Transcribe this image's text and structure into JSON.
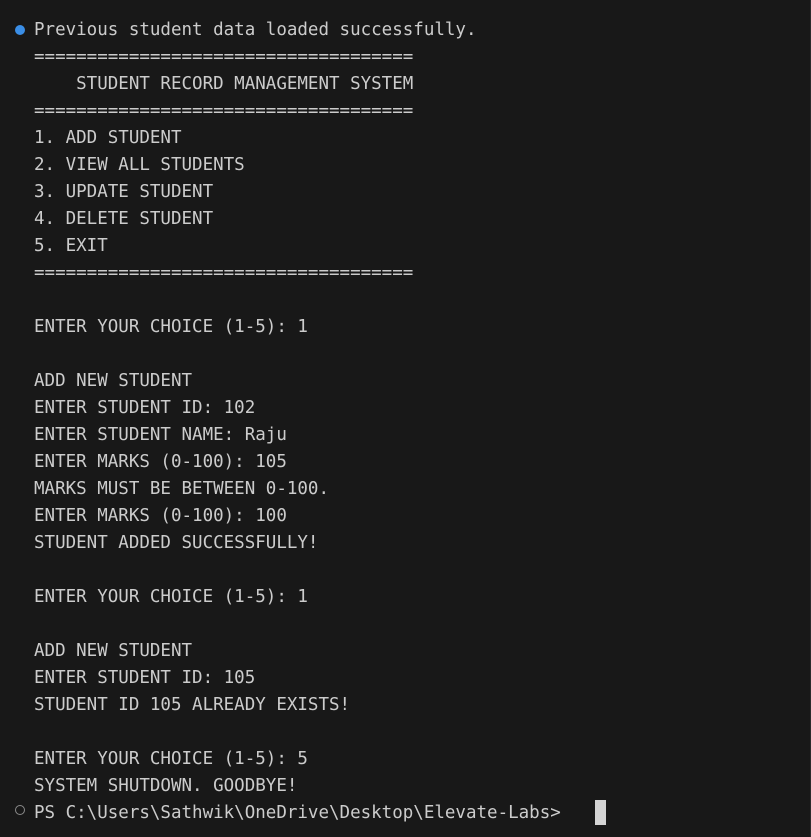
{
  "terminal": {
    "lines": [
      "Previous student data loaded successfully.",
      "====================================",
      "    STUDENT RECORD MANAGEMENT SYSTEM",
      "====================================",
      "1. ADD STUDENT",
      "2. VIEW ALL STUDENTS",
      "3. UPDATE STUDENT",
      "4. DELETE STUDENT",
      "5. EXIT",
      "====================================",
      "",
      "ENTER YOUR CHOICE (1-5): 1",
      "",
      "ADD NEW STUDENT",
      "ENTER STUDENT ID: 102",
      "ENTER STUDENT NAME: Raju",
      "ENTER MARKS (0-100): 105",
      "MARKS MUST BE BETWEEN 0-100.",
      "ENTER MARKS (0-100): 100",
      "STUDENT ADDED SUCCESSFULLY!",
      "",
      "ENTER YOUR CHOICE (1-5): 1",
      "",
      "ADD NEW STUDENT",
      "ENTER STUDENT ID: 105",
      "STUDENT ID 105 ALREADY EXISTS!",
      "",
      "ENTER YOUR CHOICE (1-5): 5",
      "SYSTEM SHUTDOWN. GOODBYE!",
      "PS C:\\Users\\Sathwik\\OneDrive\\Desktop\\Elevate-Labs> "
    ]
  },
  "colors": {
    "background": "#181818",
    "text": "#cccccc",
    "success_marker": "#3a8ee6",
    "idle_marker": "#8a8a8a",
    "cursor": "#d4d4d4"
  },
  "icons": {
    "first_marker": "command-decoration-success-icon",
    "last_marker": "command-decoration-default-icon"
  }
}
